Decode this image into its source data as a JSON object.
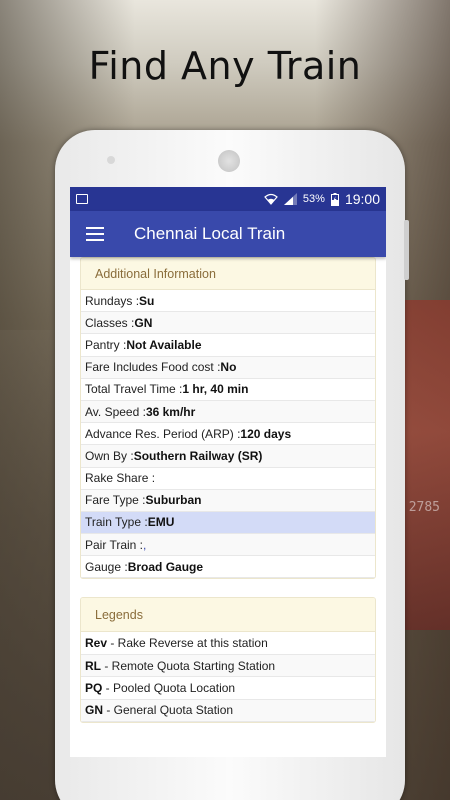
{
  "headline": "Find Any Train",
  "background": {
    "train_number": "2785"
  },
  "status_bar": {
    "battery": "53%",
    "time": "19:00",
    "icons": [
      "image-icon",
      "wifi-icon",
      "signal-icon",
      "battery-charging-icon"
    ]
  },
  "app_bar": {
    "menu_icon": "hamburger-menu-icon",
    "title": "Chennai Local Train"
  },
  "additional_info": {
    "header": "Additional Information",
    "rows": [
      {
        "label": "Rundays :",
        "value": "Su"
      },
      {
        "label": "Classes :",
        "value": "GN"
      },
      {
        "label": "Pantry :",
        "value": "Not Available"
      },
      {
        "label": "Fare Includes Food cost :",
        "value": "No"
      },
      {
        "label": "Total Travel Time :",
        "value": "1 hr, 40 min"
      },
      {
        "label": "Av. Speed :",
        "value": "36 km/hr"
      },
      {
        "label": "Advance Res. Period (ARP) :",
        "value": "120 days"
      },
      {
        "label": "Own By :",
        "value": "Southern Railway (SR)"
      },
      {
        "label": "Rake Share :",
        "value": ""
      },
      {
        "label": "Fare Type :",
        "value": "Suburban"
      },
      {
        "label": "Train Type :",
        "value": "EMU"
      },
      {
        "label": "Pair Train :",
        "value": ","
      },
      {
        "label": "Gauge :",
        "value": "Broad Gauge"
      }
    ]
  },
  "legends": {
    "header": "Legends",
    "rows": [
      {
        "code": "Rev",
        "desc": " - Rake Reverse at this station"
      },
      {
        "code": "RL",
        "desc": " - Remote Quota Starting Station"
      },
      {
        "code": "PQ",
        "desc": " - Pooled Quota Location"
      },
      {
        "code": "GN",
        "desc": " - General Quota Station"
      }
    ]
  },
  "colors": {
    "status_bar": "#283593",
    "app_bar": "#3949ab",
    "card_header_bg": "#fcf8e3",
    "card_header_text": "#8a6d3b",
    "highlight_row": "#d3dbf7"
  }
}
